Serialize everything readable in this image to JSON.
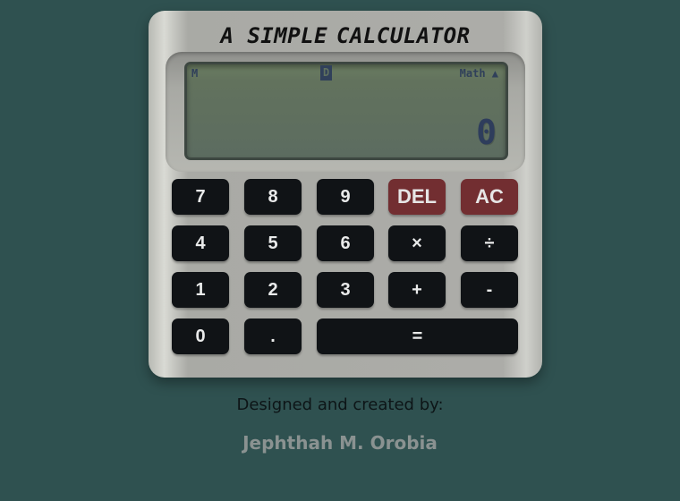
{
  "calculator": {
    "title_part1": "A SIMPLE",
    "title_part2": "CALCULATOR",
    "display": {
      "memory_indicator": "M",
      "degree_indicator": "D",
      "mode_indicator": "Math ▲",
      "value": "0"
    },
    "keys": {
      "k7": "7",
      "k8": "8",
      "k9": "9",
      "del": "DEL",
      "ac": "AC",
      "k4": "4",
      "k5": "5",
      "k6": "6",
      "multiply": "×",
      "divide": "÷",
      "k1": "1",
      "k2": "2",
      "k3": "3",
      "plus": "+",
      "minus": "-",
      "k0": "0",
      "decimal": ".",
      "equals": "="
    }
  },
  "footer": {
    "credit_line": "Designed and created by:",
    "author": "Jephthah M. Orobia"
  },
  "colors": {
    "background": "#2f5150",
    "key": "#101316",
    "key_danger": "#722e31",
    "lcd": "#5f705f"
  }
}
